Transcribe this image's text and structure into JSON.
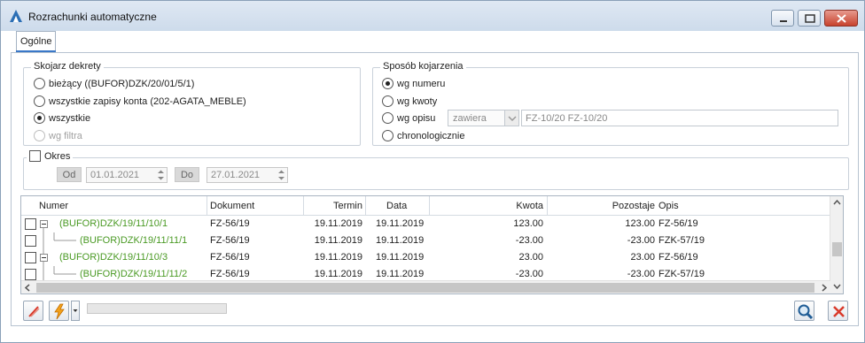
{
  "window": {
    "title": "Rozrachunki automatyczne"
  },
  "tabs": [
    {
      "label": "Ogólne"
    }
  ],
  "match_entries": {
    "legend": "Skojarz dekrety",
    "options": [
      {
        "label": "bieżący ((BUFOR)DZK/20/01/5/1)",
        "checked": false,
        "disabled": false
      },
      {
        "label": "wszystkie zapisy konta (202-AGATA_MEBLE)",
        "checked": false,
        "disabled": false
      },
      {
        "label": "wszystkie",
        "checked": true,
        "disabled": false
      },
      {
        "label": "wg filtra",
        "checked": false,
        "disabled": true
      }
    ]
  },
  "matching_method": {
    "legend": "Sposób kojarzenia",
    "options": [
      {
        "label": "wg numeru",
        "checked": true
      },
      {
        "label": "wg kwoty",
        "checked": false
      },
      {
        "label": "wg opisu",
        "checked": false
      },
      {
        "label": "chronologicznie",
        "checked": false
      }
    ],
    "description_operator": "zawiera",
    "description_value": "FZ-10/20 FZ-10/20"
  },
  "period": {
    "label": "Okres",
    "checked": false,
    "from_label": "Od",
    "from_value": "01.01.2021",
    "to_label": "Do",
    "to_value": "27.01.2021"
  },
  "table": {
    "columns": [
      "Numer",
      "Dokument",
      "Termin",
      "Data",
      "Kwota",
      "Pozostaje",
      "Opis"
    ],
    "rows": [
      {
        "numer": "(BUFOR)DZK/19/11/10/1",
        "dokument": "FZ-56/19",
        "termin": "19.11.2019",
        "data": "19.11.2019",
        "kwota": "123.00",
        "pozostaje": "123.00",
        "opis": "FZ-56/19",
        "level": 0
      },
      {
        "numer": "(BUFOR)DZK/19/11/11/1",
        "dokument": "FZ-56/19",
        "termin": "19.11.2019",
        "data": "19.11.2019",
        "kwota": "-23.00",
        "pozostaje": "-23.00",
        "opis": "FZK-57/19",
        "level": 1
      },
      {
        "numer": "(BUFOR)DZK/19/11/10/3",
        "dokument": "FZ-56/19",
        "termin": "19.11.2019",
        "data": "19.11.2019",
        "kwota": "23.00",
        "pozostaje": "23.00",
        "opis": "FZ-56/19",
        "level": 0
      },
      {
        "numer": "(BUFOR)DZK/19/11/11/2",
        "dokument": "FZ-56/19",
        "termin": "19.11.2019",
        "data": "19.11.2019",
        "kwota": "-23.00",
        "pozostaje": "-23.00",
        "opis": "FZK-57/19",
        "level": 1
      }
    ]
  },
  "colors": {
    "tree_text": "#4a9a24",
    "accent": "#3a78c8",
    "close": "#d93a2b"
  },
  "toolbar": {
    "left_icons": [
      "clear-icon",
      "lightning-icon"
    ],
    "right_icons": [
      "magnifier-icon",
      "cancel-x-icon"
    ],
    "progress": 0
  }
}
